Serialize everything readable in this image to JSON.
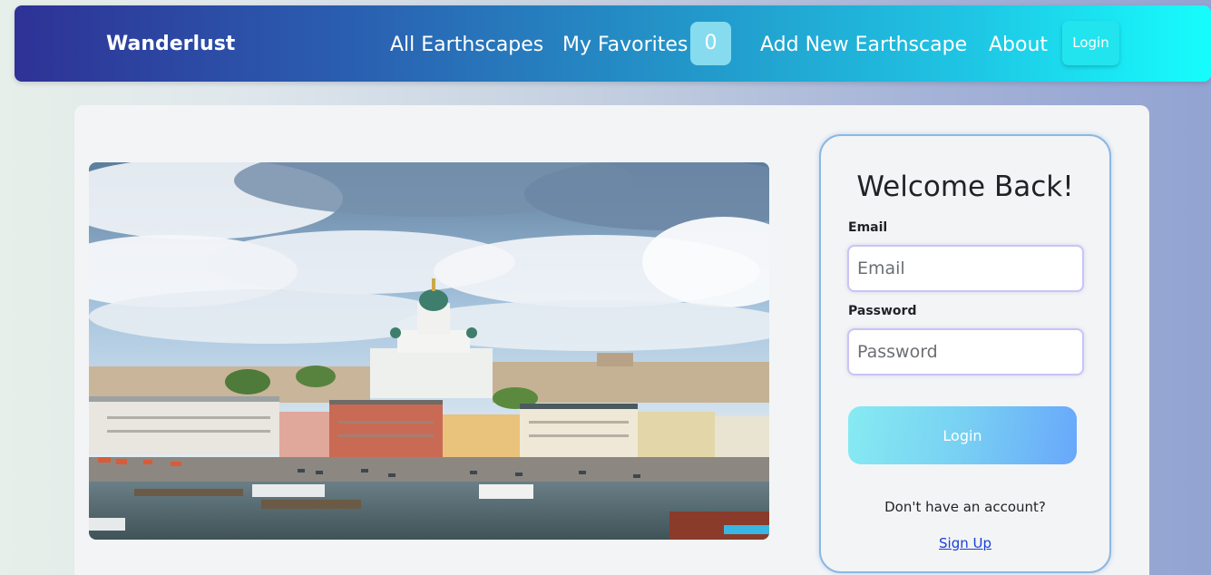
{
  "nav": {
    "brand": "Wanderlust",
    "links": [
      {
        "label": "All Earthscapes"
      },
      {
        "label": "My Favorites"
      },
      {
        "label": "Add New Earthscape"
      },
      {
        "label": "About"
      }
    ],
    "favorites_count": "0",
    "login_label": "Login"
  },
  "hero": {
    "icon": "city-harbor-photo"
  },
  "login": {
    "title": "Welcome Back!",
    "email_label": "Email",
    "email_placeholder": "Email",
    "email_value": "",
    "password_label": "Password",
    "password_placeholder": "Password",
    "password_value": "",
    "button_label": "Login",
    "signup_prompt": "Don't have an account?",
    "signup_link": "Sign Up"
  },
  "colors": {
    "nav_start": "#2e3296",
    "nav_end": "#16fdfd",
    "signup_link": "#1a3fd6"
  }
}
